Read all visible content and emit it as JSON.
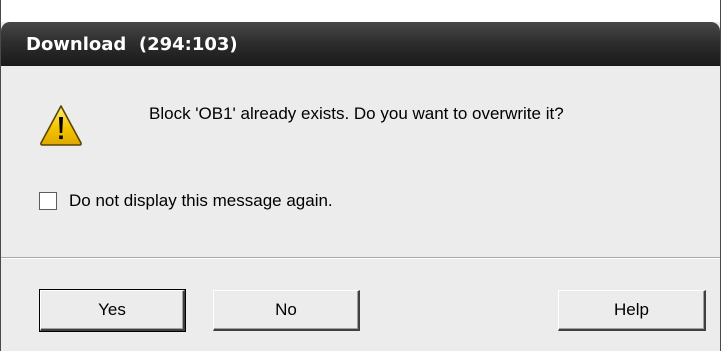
{
  "window": {
    "title": "Download  (294:103)"
  },
  "dialog": {
    "icon": "warning-icon",
    "message": "Block 'OB1' already exists. Do you want to overwrite it?",
    "checkbox": {
      "label": "Do not display this message again.",
      "checked": false
    },
    "buttons": {
      "yes": "Yes",
      "no": "No",
      "help": "Help"
    }
  },
  "colors": {
    "titlebar": "#2e2e2e",
    "dialog_bg": "#ececec",
    "warning_fill": "#f5c400"
  }
}
